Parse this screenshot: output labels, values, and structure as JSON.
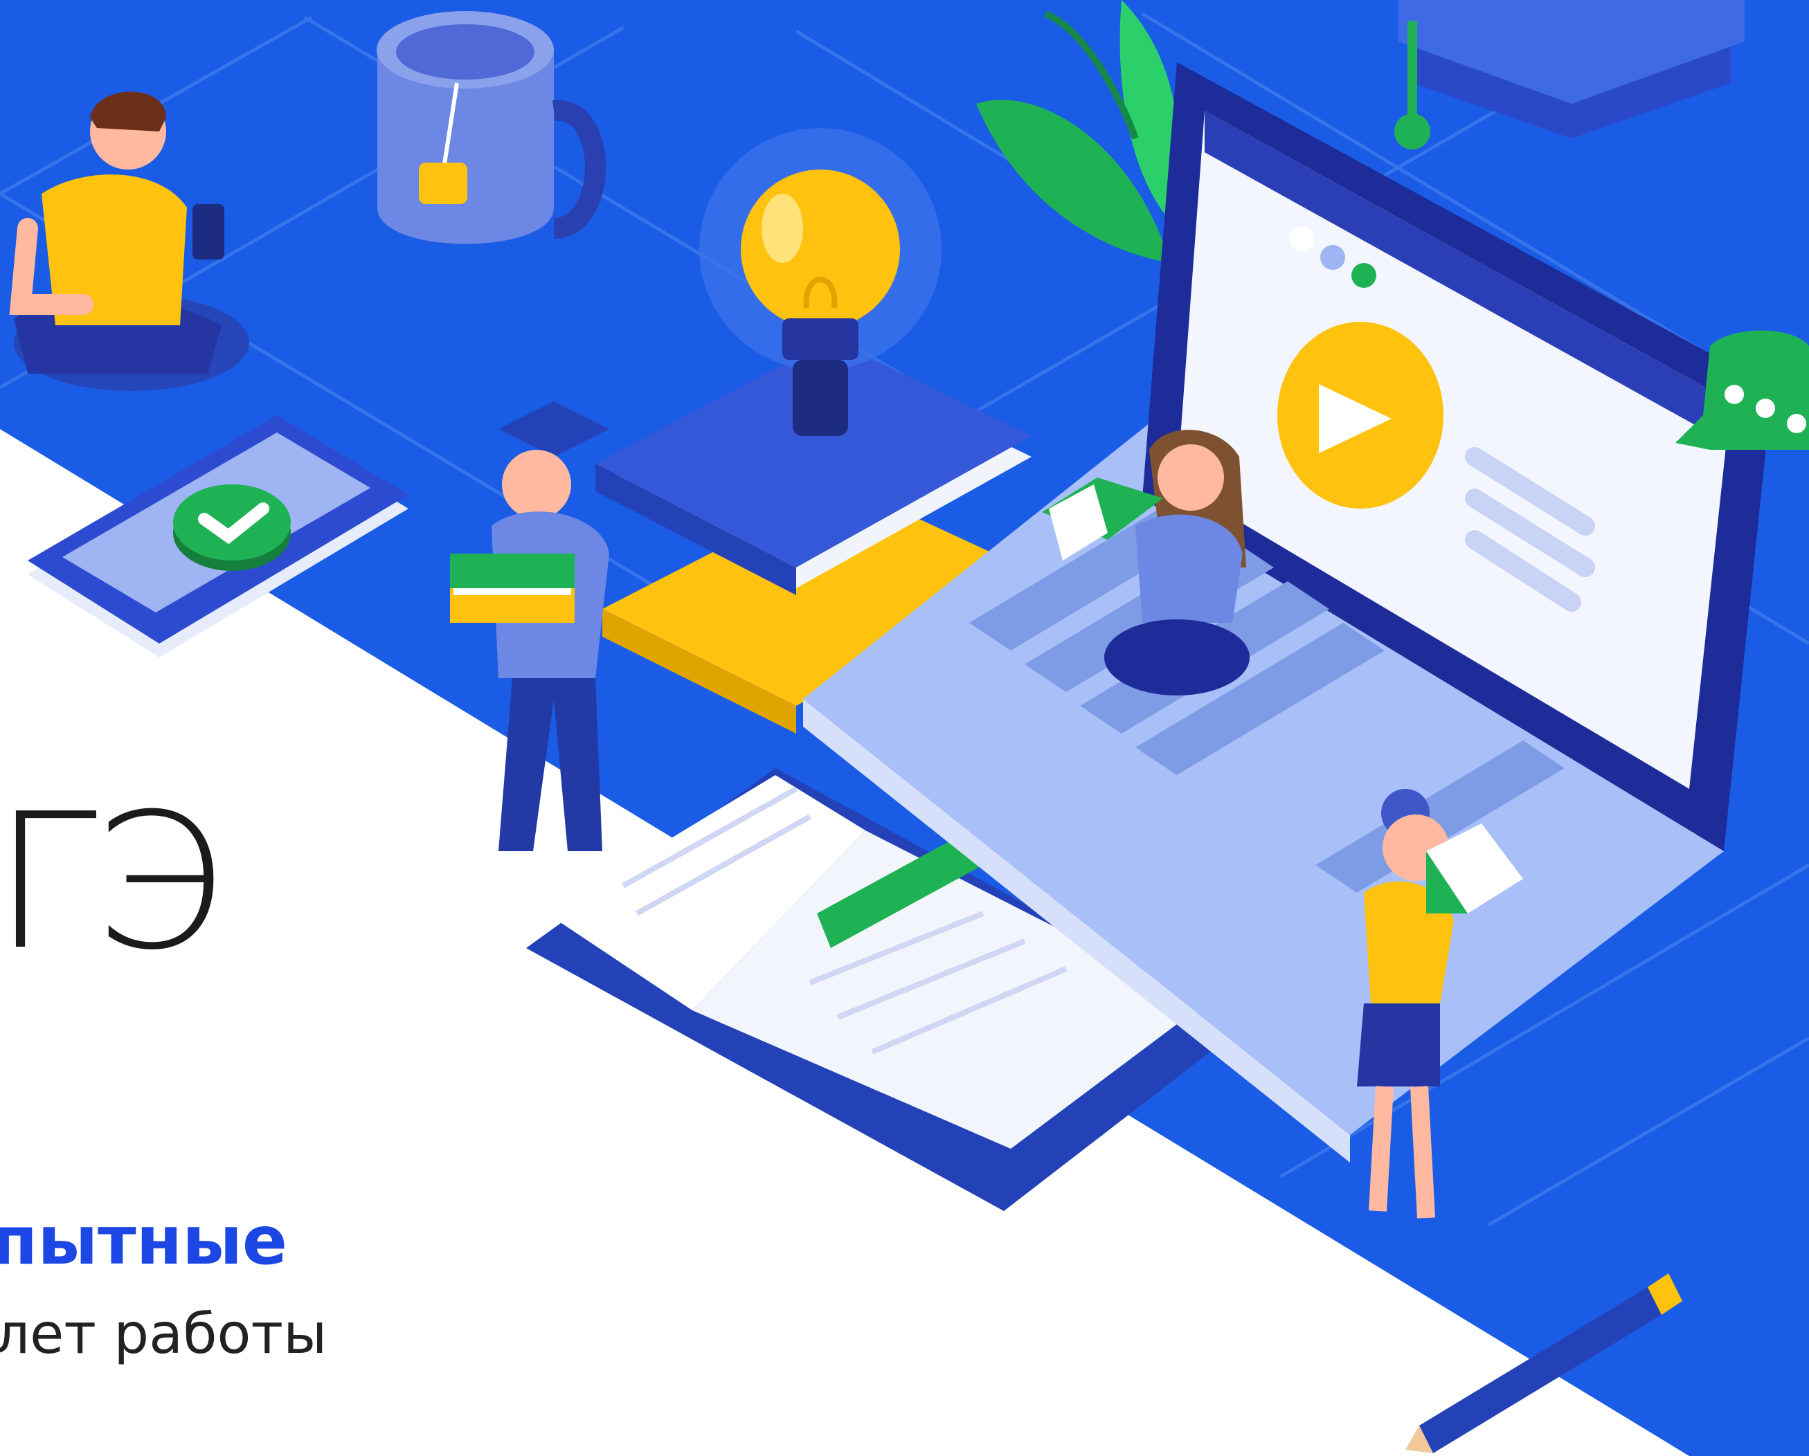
{
  "headline": {
    "heading": "ГЭ",
    "subtitle": "пытные",
    "caption": "лет работы"
  },
  "colors": {
    "background_blue": "#1a5ce6",
    "grid_blue": "#4f86f0",
    "accent_yellow": "#ffc20e",
    "accent_green": "#1fb255",
    "subtitle_blue": "#1c47e4",
    "text_dark": "#1b1b1b"
  },
  "illustration": {
    "play_icon": "play-icon",
    "check_icon": "check-icon",
    "chat_icon": "chat-bubble-icon",
    "idea_icon": "lightbulb-icon"
  }
}
